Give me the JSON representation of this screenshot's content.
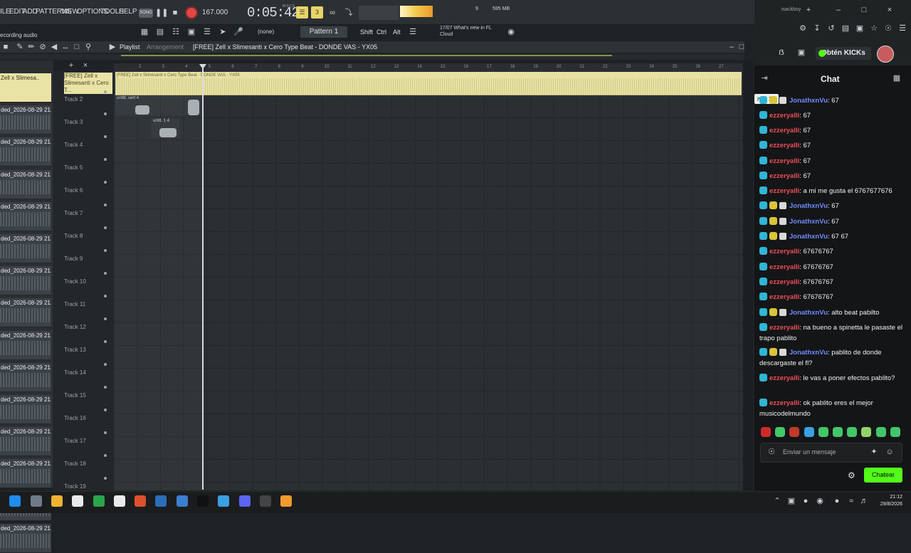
{
  "fl": {
    "menu": [
      "ILE",
      "EDIT",
      "ADD",
      "PATTERNS",
      "VIEW",
      "OPTIONS",
      "TOOLS",
      "HELP"
    ],
    "song_toggle": "SONG",
    "tempo": "167.000",
    "time": "0:05:42",
    "time_unit": "M:S:CS",
    "pattern": "Pattern 1",
    "none_label": "(none)",
    "mods": [
      "Shift",
      "Ctrl",
      "Alt"
    ],
    "news": "17/07  What's new in FL Cloud",
    "cpu": "9",
    "mem": "595 MB",
    "recording_label": "ecording audio"
  },
  "playlist": {
    "title": "Playlist",
    "subtitle": "Arrangement",
    "project_name": "[FREE] Zell x Slimesanti x Cero Type Beat - DONDE VAS - YX05",
    "clip_title": "[FREE] Zell x Slimesanti x Cero Type Beat - DONDE VAS - YX05",
    "ruler": [
      "2",
      "3",
      "4",
      "5",
      "6",
      "7",
      "8",
      "9",
      "10",
      "11",
      "12",
      "13",
      "14",
      "15",
      "16",
      "17",
      "18",
      "19",
      "20",
      "21",
      "22",
      "23",
      "24",
      "25",
      "26",
      "27"
    ],
    "track1_name": "[FREE] Zell x Slimesanti x Cero T...",
    "tracks": [
      "Track 2",
      "Track 3",
      "Track 4",
      "Track 5",
      "Track 6",
      "Track 7",
      "Track 8",
      "Track 9",
      "Track 10",
      "Track 11",
      "Track 12",
      "Track 13",
      "Track 14",
      "Track 15",
      "Track 16",
      "Track 17",
      "Track 18",
      "Track 19"
    ],
    "pattern_clips": [
      "untitl. sert 4",
      "untit. 1 4"
    ],
    "picker": [
      "Zell x Slimesa..",
      "ded_2026-08-29 21..",
      "ded_2026-08-29 21..",
      "ded_2026-08-29 21..",
      "ded_2026-08-29 21..",
      "ded_2026-08-29 21..",
      "ded_2026-08-29 21..",
      "ded_2026-08-29 21..",
      "ded_2026-08-29 21..",
      "ded_2026-08-29 21..",
      "ded_2026-08-29 21..",
      "ded_2026-08-29 21..",
      "ded_2026-08-29 21..",
      "ded_2026-08-29 21..",
      "ded_2026-08-29 21.."
    ]
  },
  "browser": {
    "tab": "isackboy",
    "get_kicks": "Obtén KICKs"
  },
  "chat": {
    "title": "Chat",
    "level": "ivel 36",
    "messages": [
      {
        "user": "JonathxnVu",
        "color": "blue",
        "badges": 3,
        "text": ": 67"
      },
      {
        "user": "ezzeryalli",
        "color": "red",
        "badges": 1,
        "text": ": 67"
      },
      {
        "user": "ezzeryalli",
        "color": "red",
        "badges": 1,
        "text": ": 67"
      },
      {
        "user": "ezzeryalli",
        "color": "red",
        "badges": 1,
        "text": ": 67"
      },
      {
        "user": "ezzeryalli",
        "color": "red",
        "badges": 1,
        "text": ": 67"
      },
      {
        "user": "ezzeryalli",
        "color": "red",
        "badges": 1,
        "text": ": 67"
      },
      {
        "user": "ezzeryalli",
        "color": "red",
        "badges": 1,
        "text": ": a mi me gusta el 6767677676"
      },
      {
        "user": "JonathxnVu",
        "color": "blue",
        "badges": 3,
        "text": ": 67"
      },
      {
        "user": "JonathxnVu",
        "color": "blue",
        "badges": 3,
        "text": ": 67"
      },
      {
        "user": "JonathxnVu",
        "color": "blue",
        "badges": 3,
        "text": ": 67 67"
      },
      {
        "user": "ezzeryalli",
        "color": "red",
        "badges": 1,
        "text": ": 67676767"
      },
      {
        "user": "ezzeryalli",
        "color": "red",
        "badges": 1,
        "text": ": 67676767"
      },
      {
        "user": "ezzeryalli",
        "color": "red",
        "badges": 1,
        "text": ": 67676767"
      },
      {
        "user": "ezzeryalli",
        "color": "red",
        "badges": 1,
        "text": ": 67676767"
      },
      {
        "user": "JonathxnVu",
        "color": "blue",
        "badges": 3,
        "text": ": alto beat pabilto"
      },
      {
        "user": "ezzeryalli",
        "color": "red",
        "badges": 1,
        "text": ": na bueno a spinetta le pasaste el trapo pablito"
      },
      {
        "user": "JonathxnVu",
        "color": "blue",
        "badges": 3,
        "text": ": pablito de donde descargaste el fl?"
      },
      {
        "user": "ezzeryalli",
        "color": "red",
        "badges": 1,
        "text": ": le vas a poner efectos pablito?"
      },
      {
        "user": "ezzeryalli",
        "color": "red",
        "badges": 1,
        "text": ": ok pablito eres el mejor musicodelmundo"
      }
    ],
    "input_placeholder": "Enviar un mensaje",
    "send_label": "Chatear"
  },
  "taskbar": {
    "time": "21:12",
    "date": "29/8/2026"
  },
  "colors": {
    "kick_green": "#53fc18",
    "clip_yellow": "#e7e2a4",
    "user_red": "#ef4f56",
    "user_blue": "#6f8bff"
  }
}
